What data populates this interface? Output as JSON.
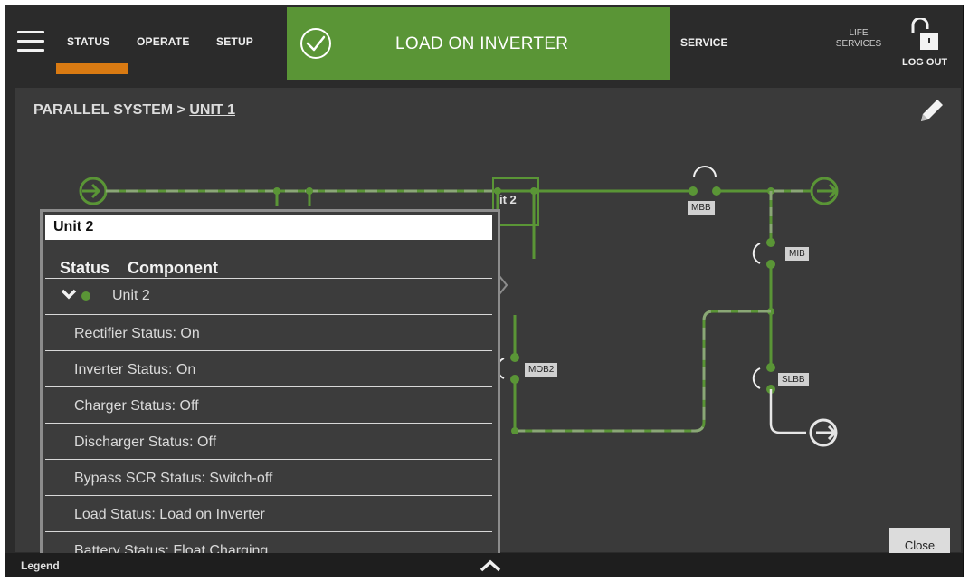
{
  "nav": {
    "tabs": [
      "STATUS",
      "OPERATE",
      "SETUP"
    ],
    "banner_text": "LOAD ON INVERTER",
    "service": "SERVICE",
    "life_services": "LIFE SERVICES",
    "logout": "LOG OUT"
  },
  "breadcrumb": {
    "parent": "PARALLEL SYSTEM >",
    "current": "UNIT 1"
  },
  "diagram": {
    "labels": [
      "MBB",
      "MIB",
      "MOB2",
      "SLBB"
    ],
    "unit_label": "it 2"
  },
  "popup": {
    "title": "Unit 2",
    "header_status": "Status",
    "header_component": "Component",
    "unit_row": "Unit 2",
    "rows": [
      "Rectifier Status: On",
      "Inverter Status: On",
      "Charger Status: Off",
      "Discharger Status: Off",
      "Bypass SCR Status: Switch-off",
      "Load Status: Load on Inverter",
      "Battery Status: Float Charging"
    ]
  },
  "close_label": "Close",
  "legend_label": "Legend",
  "colors": {
    "accent": "#d97a12",
    "ok_green": "#5a9536",
    "background": "#2b2b2b"
  }
}
